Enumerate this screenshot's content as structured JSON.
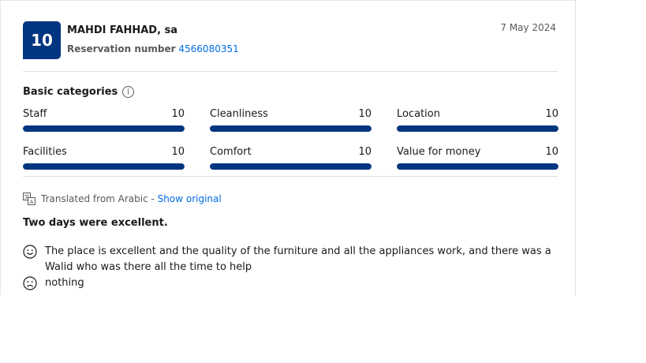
{
  "review": {
    "score": "10",
    "reviewer_name": "MAHDI FAHHAD, sa",
    "reservation_label": "Reservation number",
    "reservation_number": "4566080351",
    "date": "7 May 2024"
  },
  "categories": {
    "heading": "Basic categories",
    "info_icon": "i",
    "items": [
      {
        "label": "Staff",
        "score": "10",
        "fill": 1.0
      },
      {
        "label": "Cleanliness",
        "score": "10",
        "fill": 1.0
      },
      {
        "label": "Location",
        "score": "10",
        "fill": 1.0
      },
      {
        "label": "Facilities",
        "score": "10",
        "fill": 1.0
      },
      {
        "label": "Comfort",
        "score": "10",
        "fill": 1.0
      },
      {
        "label": "Value for money",
        "score": "10",
        "fill": 1.0
      }
    ]
  },
  "translation": {
    "text": "Translated from Arabic - ",
    "link": "Show original",
    "icon": "translate-icon"
  },
  "content": {
    "title": "Two days were excellent.",
    "positive": "The place is excellent and the quality of the furniture and all the appliances work, and there was a Walid who was there all the time to help",
    "negative": "nothing",
    "positive_icon": "smile-icon",
    "negative_icon": "frown-icon"
  },
  "colors": {
    "brand_blue": "#003580",
    "link_blue": "#006ce4",
    "muted_text": "#595959"
  }
}
